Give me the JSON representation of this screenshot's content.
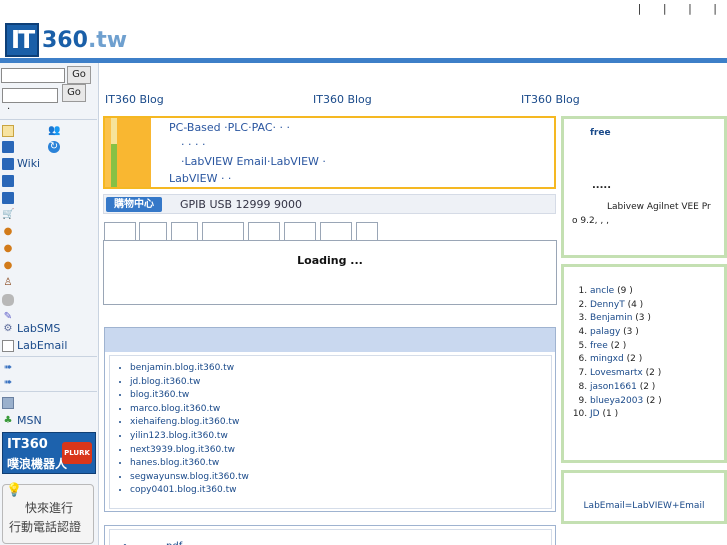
{
  "header": {
    "logo_mark": "IT",
    "logo_text": "360",
    "logo_suffix": ".tw",
    "top_separators": [
      "|",
      "|",
      "|",
      "|"
    ]
  },
  "sidebar": {
    "search_go": "Go",
    "search_go2": "Go",
    "dot": "·",
    "items": [
      {
        "icon": "book-icon",
        "label": "Wiki"
      },
      {
        "icon": "gear-icon",
        "label": "LabSMS"
      },
      {
        "icon": "mail-icon",
        "label": "LabEmail"
      },
      {
        "icon": "msn-icon",
        "label": "MSN"
      }
    ],
    "plurk": {
      "line1": "IT360",
      "line2": "噗浪機器人",
      "badge": "PLURK"
    },
    "phone": {
      "line1": "快來進行",
      "line2": "行動電話認證"
    }
  },
  "main": {
    "blog_tabs": [
      "IT360 Blog",
      "IT360 Blog",
      "IT360 Blog"
    ],
    "promo": {
      "line1": "PC-Based   ·PLC·PAC·    ·    ·",
      "line2": "·     ·   ·   ·",
      "line3": "·LabVIEW  Email·LabVIEW      ·",
      "line4": "LabVIEW    ·    ·"
    },
    "shop": {
      "button": "購物中心",
      "text": "GPIB USB  12999    9000"
    },
    "loading": "Loading ...",
    "blogs": [
      "benjamin.blog.it360.tw",
      "jd.blog.it360.tw",
      "blog.it360.tw",
      "marco.blog.it360.tw",
      "xiehaifeng.blog.it360.tw",
      "yilin123.blog.it360.tw",
      "next3939.blog.it360.tw",
      "hanes.blog.it360.tw",
      "segwayunsw.blog.it360.tw",
      "copy0401.blog.it360.tw"
    ],
    "pdf_item": "pdf"
  },
  "right": {
    "box1": {
      "free": "free",
      "dots": ".....",
      "line1": "Labivew    Agilnet VEE Pr",
      "line2": "o 9.2,          ,       ,"
    },
    "ranking": [
      {
        "name": "ancle",
        "count": "(9 )"
      },
      {
        "name": "DennyT",
        "count": "(4 )"
      },
      {
        "name": "Benjamin",
        "count": "(3 )"
      },
      {
        "name": "palagy",
        "count": "(3 )"
      },
      {
        "name": "free",
        "count": "(2 )"
      },
      {
        "name": "mingxd",
        "count": "(2 )"
      },
      {
        "name": "Lovesmartx",
        "count": "(2 )"
      },
      {
        "name": "jason1661",
        "count": "(2 )"
      },
      {
        "name": "blueya2003",
        "count": "(2 )"
      },
      {
        "name": "JD",
        "count": "(1 )"
      }
    ],
    "box3": "LabEmail=LabVIEW+Email"
  }
}
